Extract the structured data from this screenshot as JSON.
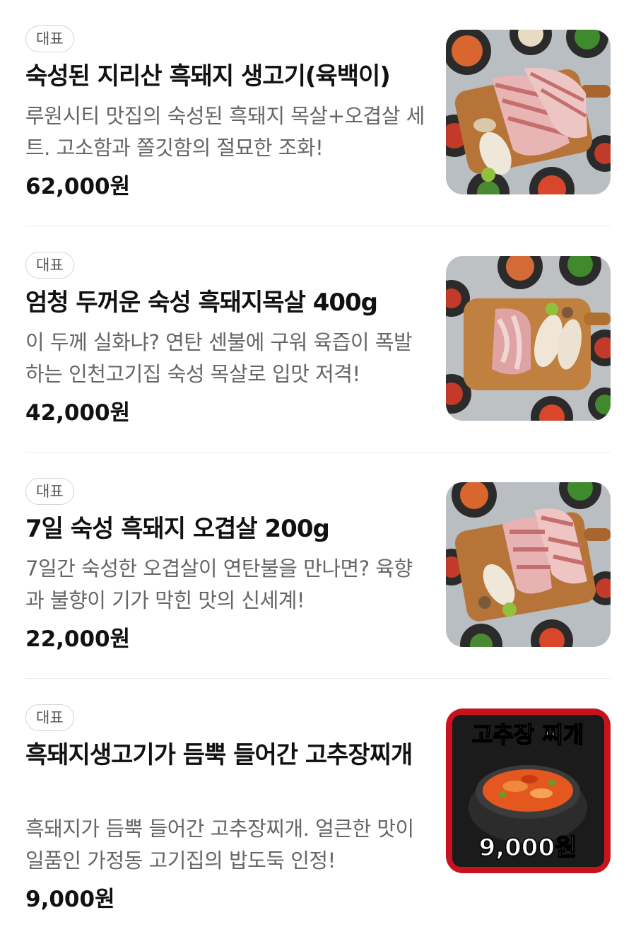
{
  "menu": {
    "items": [
      {
        "badge": "대표",
        "title": "숙성된 지리산 흑돼지 생고기(육백이)",
        "description": "루원시티 맛집의 숙성된 흑돼지 목살+오겹살 세트. 고소함과 쫄깃함의 절묘한 조화!",
        "price": "62,000원",
        "image_desc": "pork-belly-on-wooden-board"
      },
      {
        "badge": "대표",
        "title": "엄청 두꺼운 숙성 흑돼지목살 400g",
        "description": "이 두께 실화냐? 연탄 센불에 구워 육즙이 폭발하는 인천고기집 숙성 목살로 입맛 저격!",
        "price": "42,000원",
        "image_desc": "pork-neck-with-mushrooms-on-board"
      },
      {
        "badge": "대표",
        "title": "7일 숙성 흑돼지 오겹살 200g",
        "description": "7일간 숙성한 오겹살이 연탄불을 만나면? 육향과 불향이 기가 막힌 맛의 신세계!",
        "price": "22,000원",
        "image_desc": "pork-belly-slices-on-board"
      },
      {
        "badge": "대표",
        "title": "흑돼지생고기가 듬뿍 들어간 고추장찌개",
        "description": "흑돼지가 듬뿍 들어간 고추장찌개. 얼큰한 맛이 일품인 가정동 고기집의 밥도둑 인정!",
        "price": "9,000원",
        "image_desc": "gochujang-stew-in-stone-pot",
        "image_title": "고추장 찌개",
        "image_price": "9,000원"
      }
    ]
  },
  "colors": {
    "badge_border": "#d5d5d5",
    "description_text": "#666666",
    "stew_frame": "#c8131f"
  }
}
